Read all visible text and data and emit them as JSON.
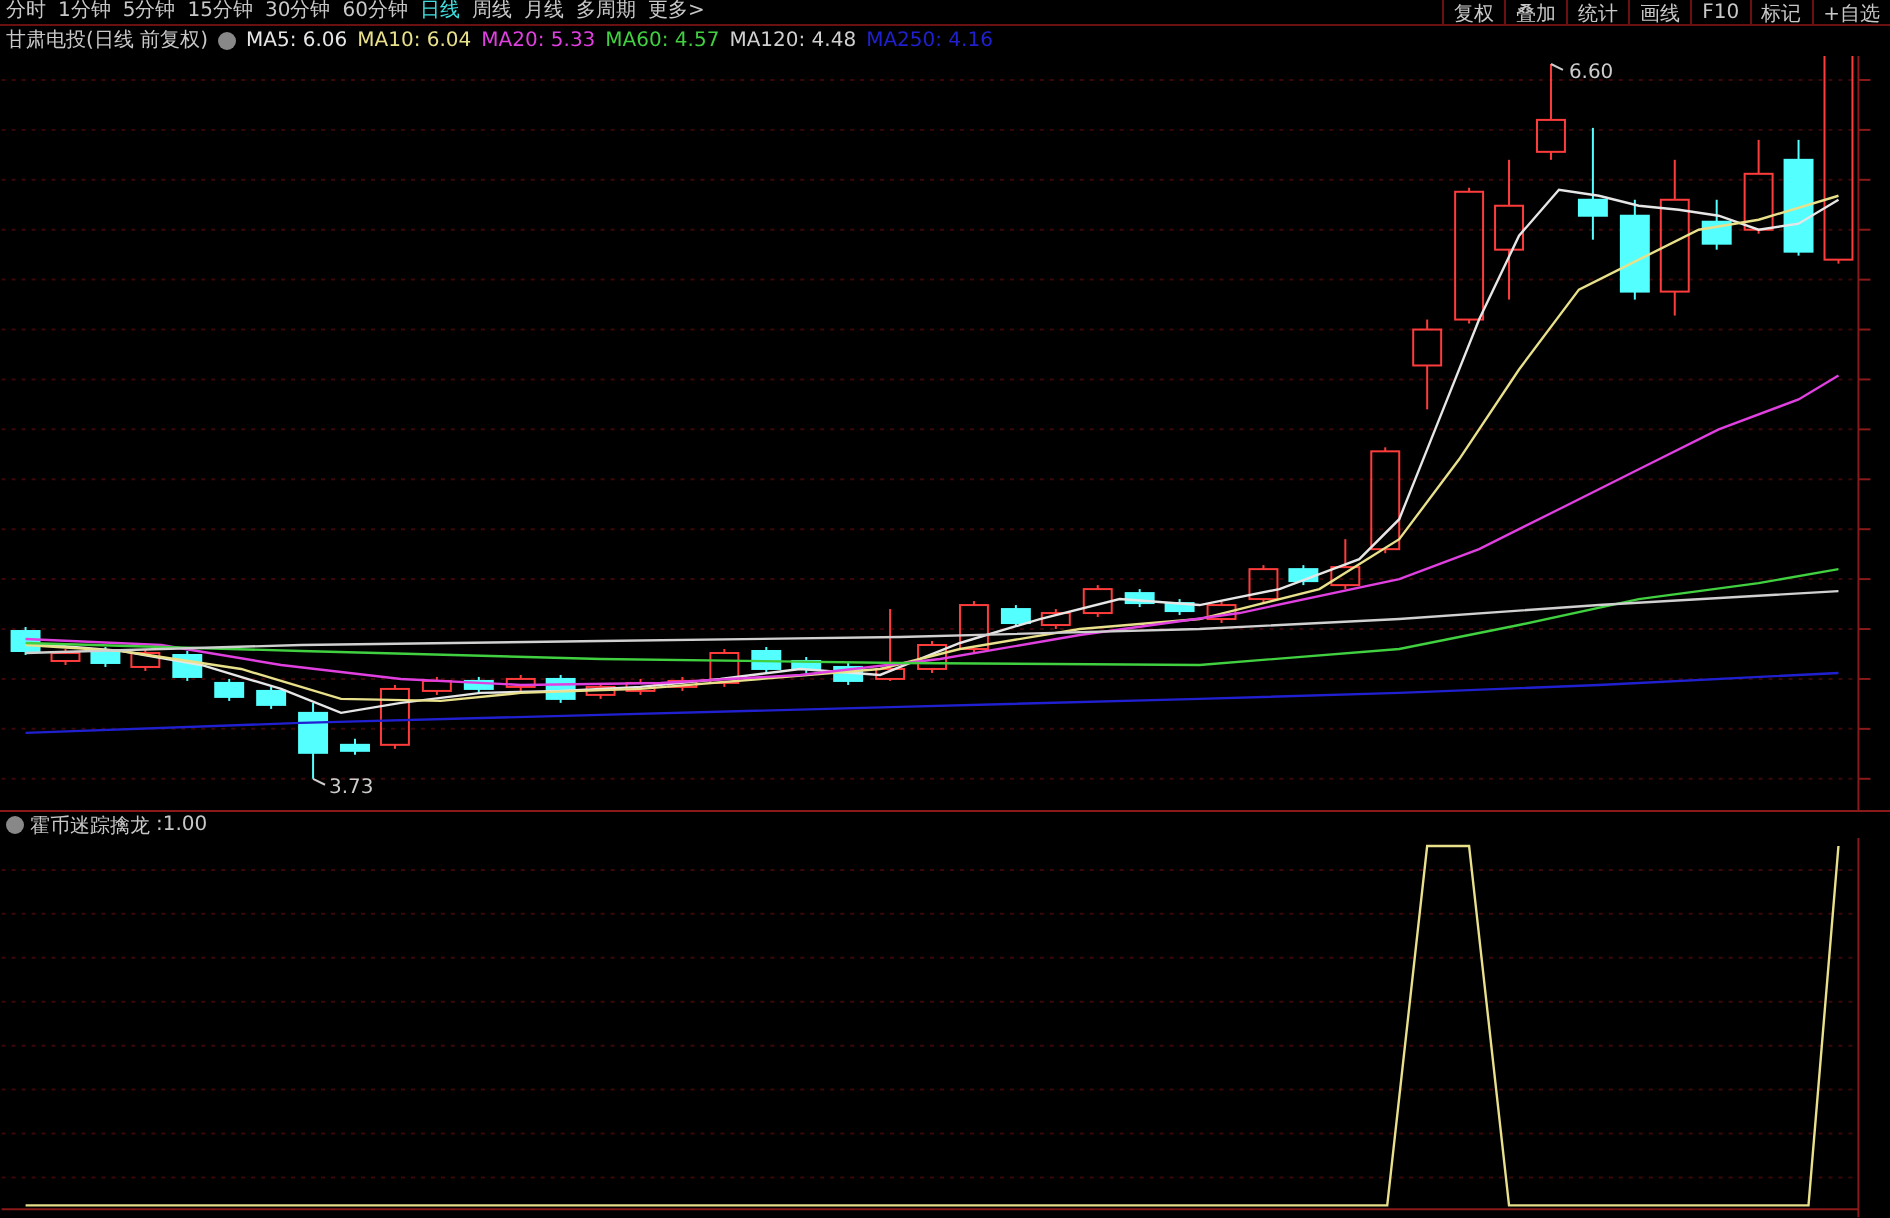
{
  "periods": [
    {
      "label": "分时",
      "selected": false
    },
    {
      "label": "1分钟",
      "selected": false
    },
    {
      "label": "5分钟",
      "selected": false
    },
    {
      "label": "15分钟",
      "selected": false
    },
    {
      "label": "30分钟",
      "selected": false
    },
    {
      "label": "60分钟",
      "selected": false
    },
    {
      "label": "日线",
      "selected": true
    },
    {
      "label": "周线",
      "selected": false
    },
    {
      "label": "月线",
      "selected": false
    },
    {
      "label": "多周期",
      "selected": false
    },
    {
      "label": "更多>",
      "selected": false
    }
  ],
  "tools": [
    "复权",
    "叠加",
    "统计",
    "画线",
    "F10",
    "标记",
    "+自选"
  ],
  "legend": {
    "title": "甘肃电投(日线 前复权)",
    "averages": [
      {
        "label": "MA5: 6.06",
        "color": "#e6e6e6"
      },
      {
        "label": "MA10: 6.04",
        "color": "#e8e08a"
      },
      {
        "label": "MA20: 5.33",
        "color": "#e040e0"
      },
      {
        "label": "MA60: 4.57",
        "color": "#40d040"
      },
      {
        "label": "MA120: 4.48",
        "color": "#d0d0d0"
      },
      {
        "label": "MA250: 4.16",
        "color": "#2020d0"
      }
    ]
  },
  "price_chart": {
    "high_label": "6.60",
    "low_label": "3.73"
  },
  "indicator": {
    "name": "霍币迷踪擒龙",
    "value": ":1.00"
  }
}
